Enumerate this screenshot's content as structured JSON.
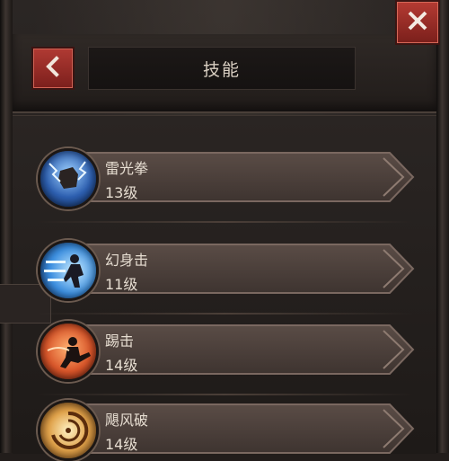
{
  "header": {
    "title": "技能",
    "back_icon": "chevron-left-icon",
    "close_icon": "close-icon"
  },
  "skills": [
    {
      "name": "雷光拳",
      "level": "13级",
      "icon": "lightning-fist-icon",
      "accent": "#3b7fd6"
    },
    {
      "name": "幻身击",
      "level": "11级",
      "icon": "dash-strike-icon",
      "accent": "#2f8ee0"
    },
    {
      "name": "踢击",
      "level": "14级",
      "icon": "kick-icon",
      "accent": "#d9562a"
    },
    {
      "name": "飓风破",
      "level": "14级",
      "icon": "whirlwind-icon",
      "accent": "#e0a24a"
    }
  ],
  "colors": {
    "button_red": "#a33730",
    "text": "#e6ddd1",
    "background": "#221d1b"
  }
}
